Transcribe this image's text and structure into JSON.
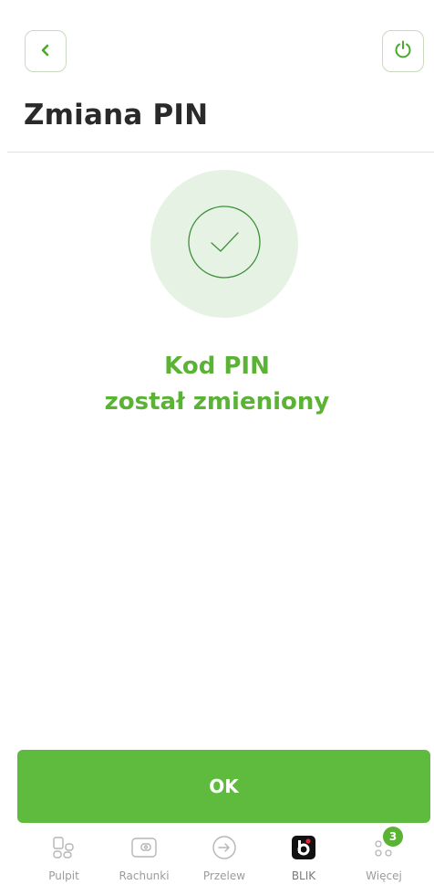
{
  "header": {
    "back_icon": "chevron-left-icon",
    "power_icon": "power-icon",
    "title": "Zmiana PIN"
  },
  "success": {
    "icon": "checkmark-icon",
    "line1": "Kod PIN",
    "line2": "został zmieniony"
  },
  "actions": {
    "ok_label": "OK"
  },
  "nav": {
    "items": [
      {
        "label": "Pulpit",
        "icon": "dashboard-icon"
      },
      {
        "label": "Rachunki",
        "icon": "wallet-icon"
      },
      {
        "label": "Przelew",
        "icon": "transfer-icon"
      },
      {
        "label": "BLIK",
        "icon": "blik-icon"
      },
      {
        "label": "Więcej",
        "icon": "more-icon",
        "badge": "3"
      }
    ]
  },
  "colors": {
    "accent": "#5ab334",
    "button": "#5fbb3d",
    "circle": "#e6f3e4"
  }
}
